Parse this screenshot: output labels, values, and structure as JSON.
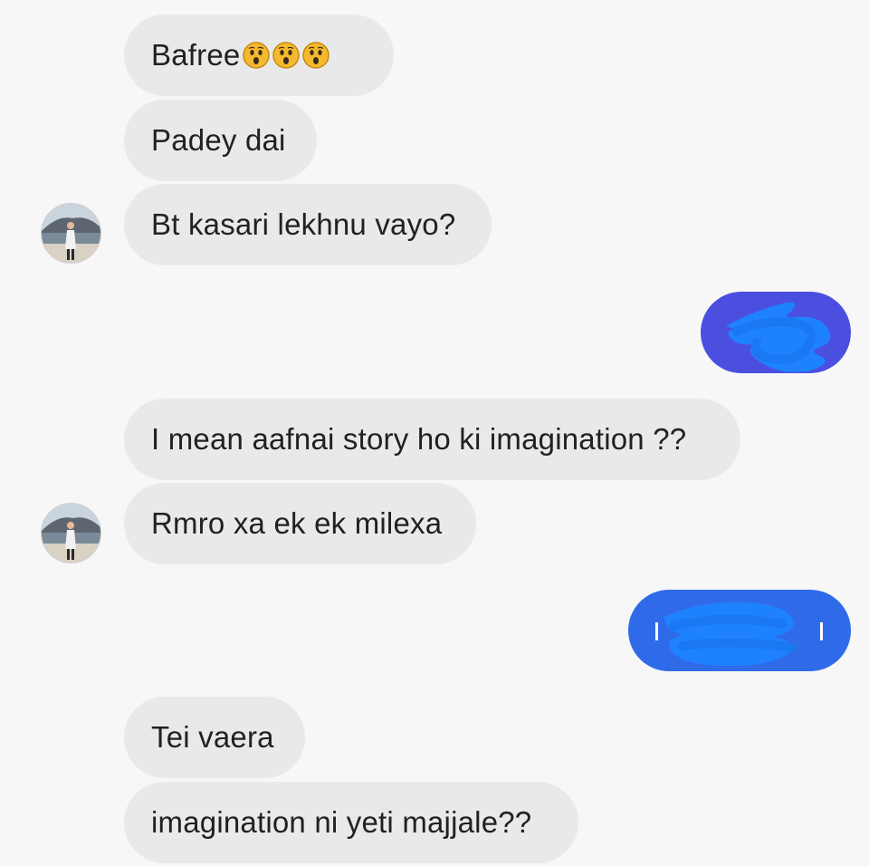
{
  "chat": {
    "messages": [
      {
        "sender": "them",
        "text": "Bafree",
        "emoji": [
          "astonished-face-emoji",
          "astonished-face-emoji",
          "astonished-face-emoji"
        ]
      },
      {
        "sender": "them",
        "text": "Padey dai"
      },
      {
        "sender": "them",
        "text": "Bt kasari lekhnu vayo?"
      },
      {
        "sender": "me",
        "text": ""
      },
      {
        "sender": "them",
        "text": "I mean aafnai story ho ki imagination ??"
      },
      {
        "sender": "them",
        "text": "Rmro xa ek ek milexa"
      },
      {
        "sender": "me",
        "text": ""
      },
      {
        "sender": "them",
        "text": "Tei vaera"
      },
      {
        "sender": "them",
        "text": "imagination ni yeti majjale??"
      }
    ]
  },
  "colors": {
    "incoming_bubble": "#e9e9e9",
    "outgoing_bubble_1": "#4a4fe0",
    "outgoing_bubble_2": "#2f6be8",
    "redaction_scribble": "#1e82ff",
    "background": "#f7f7f7"
  }
}
